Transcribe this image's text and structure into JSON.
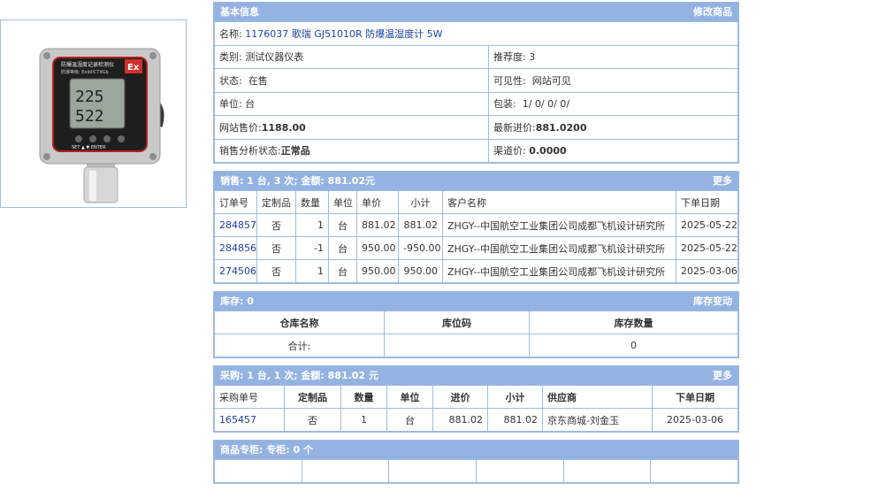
{
  "basic": {
    "title": "基本信息",
    "edit_label": "修改商品",
    "name_label": "名称:",
    "name_value": "1176037 歌瑞 GJ51010R 防爆温湿度计 5W",
    "category_label": "类别:",
    "category_value": "测试仪器仪表",
    "recommend_label": "推荐度:",
    "recommend_value": "3",
    "status_label": "状态:",
    "status_value": "在售",
    "visibility_label": "可见性:",
    "visibility_value": "网站可见",
    "unit_label": "单位:",
    "unit_value": "台",
    "package_label": "包装:",
    "package_value": "1/ 0/ 0/ 0/",
    "web_price_label": "网站售价:",
    "web_price_value": "1188.00",
    "latest_price_label": "最新进价:",
    "latest_price_value": "881.0200",
    "sales_status_label": "销售分析状态:",
    "sales_status_value": "正常品",
    "channel_price_label": "渠道价:",
    "channel_price_value": "0.0000"
  },
  "sales": {
    "title": "销售:  1 台, 3 次; 金额: 881.02元",
    "more_label": "更多",
    "columns": [
      "订单号",
      "定制品",
      "数量",
      "单位",
      "单价",
      "小计",
      "客户名称",
      "下单日期"
    ],
    "rows": [
      {
        "order": "284857",
        "custom": "否",
        "qty": "1",
        "unit": "台",
        "price": "881.02",
        "subtotal": "881.02",
        "customer": "ZHGY--中国航空工业集团公司成都飞机设计研究所",
        "date": "2025-05-22"
      },
      {
        "order": "284856",
        "custom": "否",
        "qty": "-1",
        "unit": "台",
        "price": "950.00",
        "subtotal": "-950.00",
        "customer": "ZHGY--中国航空工业集团公司成都飞机设计研究所",
        "date": "2025-05-22"
      },
      {
        "order": "274506",
        "custom": "否",
        "qty": "1",
        "unit": "台",
        "price": "950.00",
        "subtotal": "950.00",
        "customer": "ZHGY--中国航空工业集团公司成都飞机设计研究所",
        "date": "2025-03-06"
      }
    ]
  },
  "stock": {
    "title": "库存:  0",
    "change_label": "库存变动",
    "columns": [
      "仓库名称",
      "库位码",
      "库存数量"
    ],
    "total_label": "合计:",
    "total_value": "0"
  },
  "purchase": {
    "title": "采购:  1 台, 1 次; 金额: 881.02 元",
    "more_label": "更多",
    "columns": [
      "采购单号",
      "定制品",
      "数量",
      "单位",
      "进价",
      "小计",
      "供应商",
      "下单日期"
    ],
    "rows": [
      {
        "order": "165457",
        "custom": "否",
        "qty": "1",
        "unit": "台",
        "price": "881.02",
        "subtotal": "881.02",
        "supplier": "京东商城-刘金玉",
        "date": "2025-03-06"
      }
    ]
  },
  "cabinet": {
    "title": "商品专柜:  专柜: 0 个"
  },
  "device": {
    "brand_text": "防爆温湿度记录检测仪",
    "ex_text": "Ex",
    "rating_text": "防爆等级: ExibIICT4Gb",
    "reading_top": "225",
    "reading_bottom": "522",
    "buttons_text": "SET ▲ ▼ ENTER"
  }
}
